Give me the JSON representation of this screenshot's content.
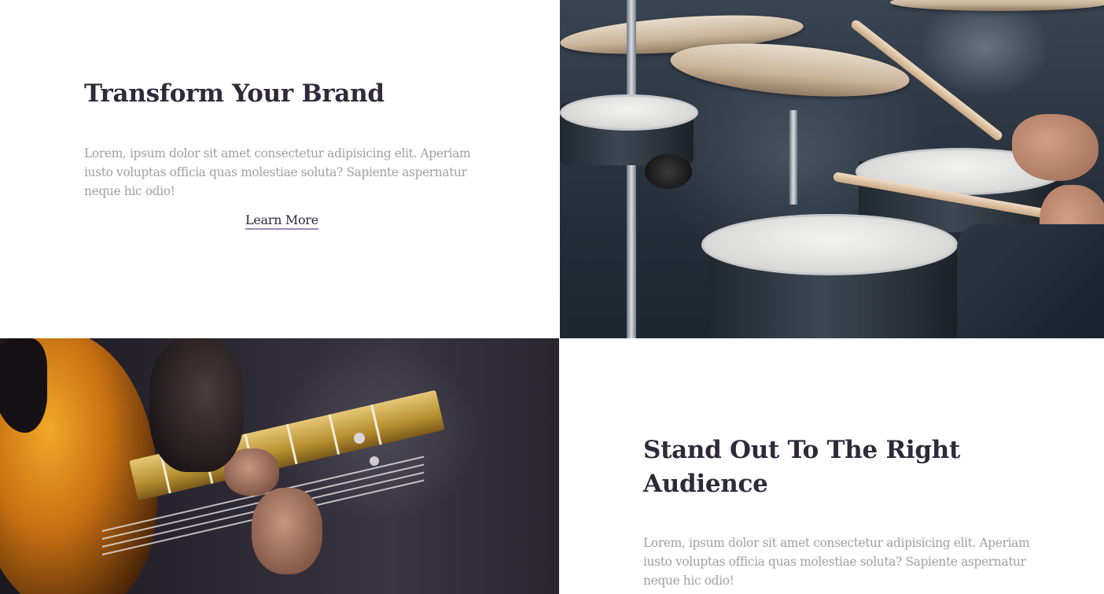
{
  "section_1": {
    "title": "Transform Your Brand",
    "body": "Lorem, ipsum dolor sit amet consectetur adipisicing elit. Aperiam iusto voluptas officia quas molestiae soluta? Sapiente aspernatur neque hic odio!",
    "cta": "Learn More"
  },
  "section_2": {
    "title": "Stand Out To The Right Audience",
    "body": "Lorem, ipsum dolor sit amet consectetur adipisicing elit. Aperiam iusto voluptas officia quas molestiae soluta? Sapiente aspernatur neque hic odio!"
  },
  "colors": {
    "heading": "#2f2a3a",
    "body_text": "#a4a0a0",
    "link_underline": "#9d8ab8",
    "background": "#ffffff"
  }
}
